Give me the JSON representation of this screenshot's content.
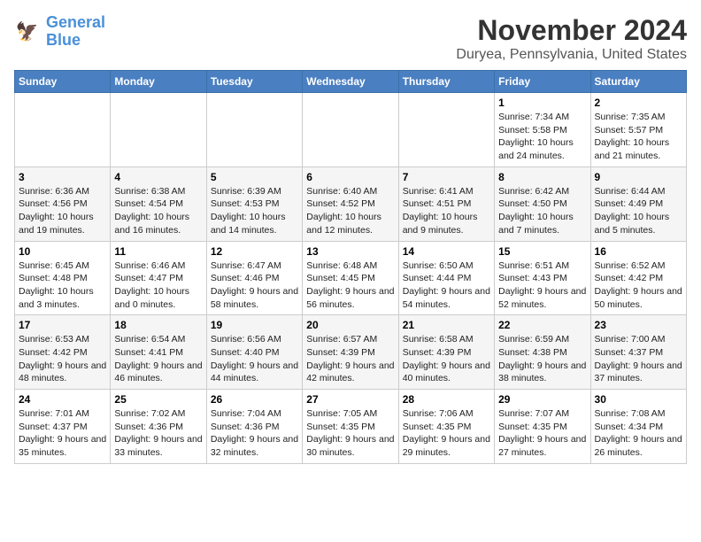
{
  "header": {
    "logo_line1": "General",
    "logo_line2": "Blue",
    "title": "November 2024",
    "location": "Duryea, Pennsylvania, United States"
  },
  "weekdays": [
    "Sunday",
    "Monday",
    "Tuesday",
    "Wednesday",
    "Thursday",
    "Friday",
    "Saturday"
  ],
  "weeks": [
    [
      {
        "day": "",
        "info": ""
      },
      {
        "day": "",
        "info": ""
      },
      {
        "day": "",
        "info": ""
      },
      {
        "day": "",
        "info": ""
      },
      {
        "day": "",
        "info": ""
      },
      {
        "day": "1",
        "info": "Sunrise: 7:34 AM\nSunset: 5:58 PM\nDaylight: 10 hours and 24 minutes."
      },
      {
        "day": "2",
        "info": "Sunrise: 7:35 AM\nSunset: 5:57 PM\nDaylight: 10 hours and 21 minutes."
      }
    ],
    [
      {
        "day": "3",
        "info": "Sunrise: 6:36 AM\nSunset: 4:56 PM\nDaylight: 10 hours and 19 minutes."
      },
      {
        "day": "4",
        "info": "Sunrise: 6:38 AM\nSunset: 4:54 PM\nDaylight: 10 hours and 16 minutes."
      },
      {
        "day": "5",
        "info": "Sunrise: 6:39 AM\nSunset: 4:53 PM\nDaylight: 10 hours and 14 minutes."
      },
      {
        "day": "6",
        "info": "Sunrise: 6:40 AM\nSunset: 4:52 PM\nDaylight: 10 hours and 12 minutes."
      },
      {
        "day": "7",
        "info": "Sunrise: 6:41 AM\nSunset: 4:51 PM\nDaylight: 10 hours and 9 minutes."
      },
      {
        "day": "8",
        "info": "Sunrise: 6:42 AM\nSunset: 4:50 PM\nDaylight: 10 hours and 7 minutes."
      },
      {
        "day": "9",
        "info": "Sunrise: 6:44 AM\nSunset: 4:49 PM\nDaylight: 10 hours and 5 minutes."
      }
    ],
    [
      {
        "day": "10",
        "info": "Sunrise: 6:45 AM\nSunset: 4:48 PM\nDaylight: 10 hours and 3 minutes."
      },
      {
        "day": "11",
        "info": "Sunrise: 6:46 AM\nSunset: 4:47 PM\nDaylight: 10 hours and 0 minutes."
      },
      {
        "day": "12",
        "info": "Sunrise: 6:47 AM\nSunset: 4:46 PM\nDaylight: 9 hours and 58 minutes."
      },
      {
        "day": "13",
        "info": "Sunrise: 6:48 AM\nSunset: 4:45 PM\nDaylight: 9 hours and 56 minutes."
      },
      {
        "day": "14",
        "info": "Sunrise: 6:50 AM\nSunset: 4:44 PM\nDaylight: 9 hours and 54 minutes."
      },
      {
        "day": "15",
        "info": "Sunrise: 6:51 AM\nSunset: 4:43 PM\nDaylight: 9 hours and 52 minutes."
      },
      {
        "day": "16",
        "info": "Sunrise: 6:52 AM\nSunset: 4:42 PM\nDaylight: 9 hours and 50 minutes."
      }
    ],
    [
      {
        "day": "17",
        "info": "Sunrise: 6:53 AM\nSunset: 4:42 PM\nDaylight: 9 hours and 48 minutes."
      },
      {
        "day": "18",
        "info": "Sunrise: 6:54 AM\nSunset: 4:41 PM\nDaylight: 9 hours and 46 minutes."
      },
      {
        "day": "19",
        "info": "Sunrise: 6:56 AM\nSunset: 4:40 PM\nDaylight: 9 hours and 44 minutes."
      },
      {
        "day": "20",
        "info": "Sunrise: 6:57 AM\nSunset: 4:39 PM\nDaylight: 9 hours and 42 minutes."
      },
      {
        "day": "21",
        "info": "Sunrise: 6:58 AM\nSunset: 4:39 PM\nDaylight: 9 hours and 40 minutes."
      },
      {
        "day": "22",
        "info": "Sunrise: 6:59 AM\nSunset: 4:38 PM\nDaylight: 9 hours and 38 minutes."
      },
      {
        "day": "23",
        "info": "Sunrise: 7:00 AM\nSunset: 4:37 PM\nDaylight: 9 hours and 37 minutes."
      }
    ],
    [
      {
        "day": "24",
        "info": "Sunrise: 7:01 AM\nSunset: 4:37 PM\nDaylight: 9 hours and 35 minutes."
      },
      {
        "day": "25",
        "info": "Sunrise: 7:02 AM\nSunset: 4:36 PM\nDaylight: 9 hours and 33 minutes."
      },
      {
        "day": "26",
        "info": "Sunrise: 7:04 AM\nSunset: 4:36 PM\nDaylight: 9 hours and 32 minutes."
      },
      {
        "day": "27",
        "info": "Sunrise: 7:05 AM\nSunset: 4:35 PM\nDaylight: 9 hours and 30 minutes."
      },
      {
        "day": "28",
        "info": "Sunrise: 7:06 AM\nSunset: 4:35 PM\nDaylight: 9 hours and 29 minutes."
      },
      {
        "day": "29",
        "info": "Sunrise: 7:07 AM\nSunset: 4:35 PM\nDaylight: 9 hours and 27 minutes."
      },
      {
        "day": "30",
        "info": "Sunrise: 7:08 AM\nSunset: 4:34 PM\nDaylight: 9 hours and 26 minutes."
      }
    ]
  ]
}
